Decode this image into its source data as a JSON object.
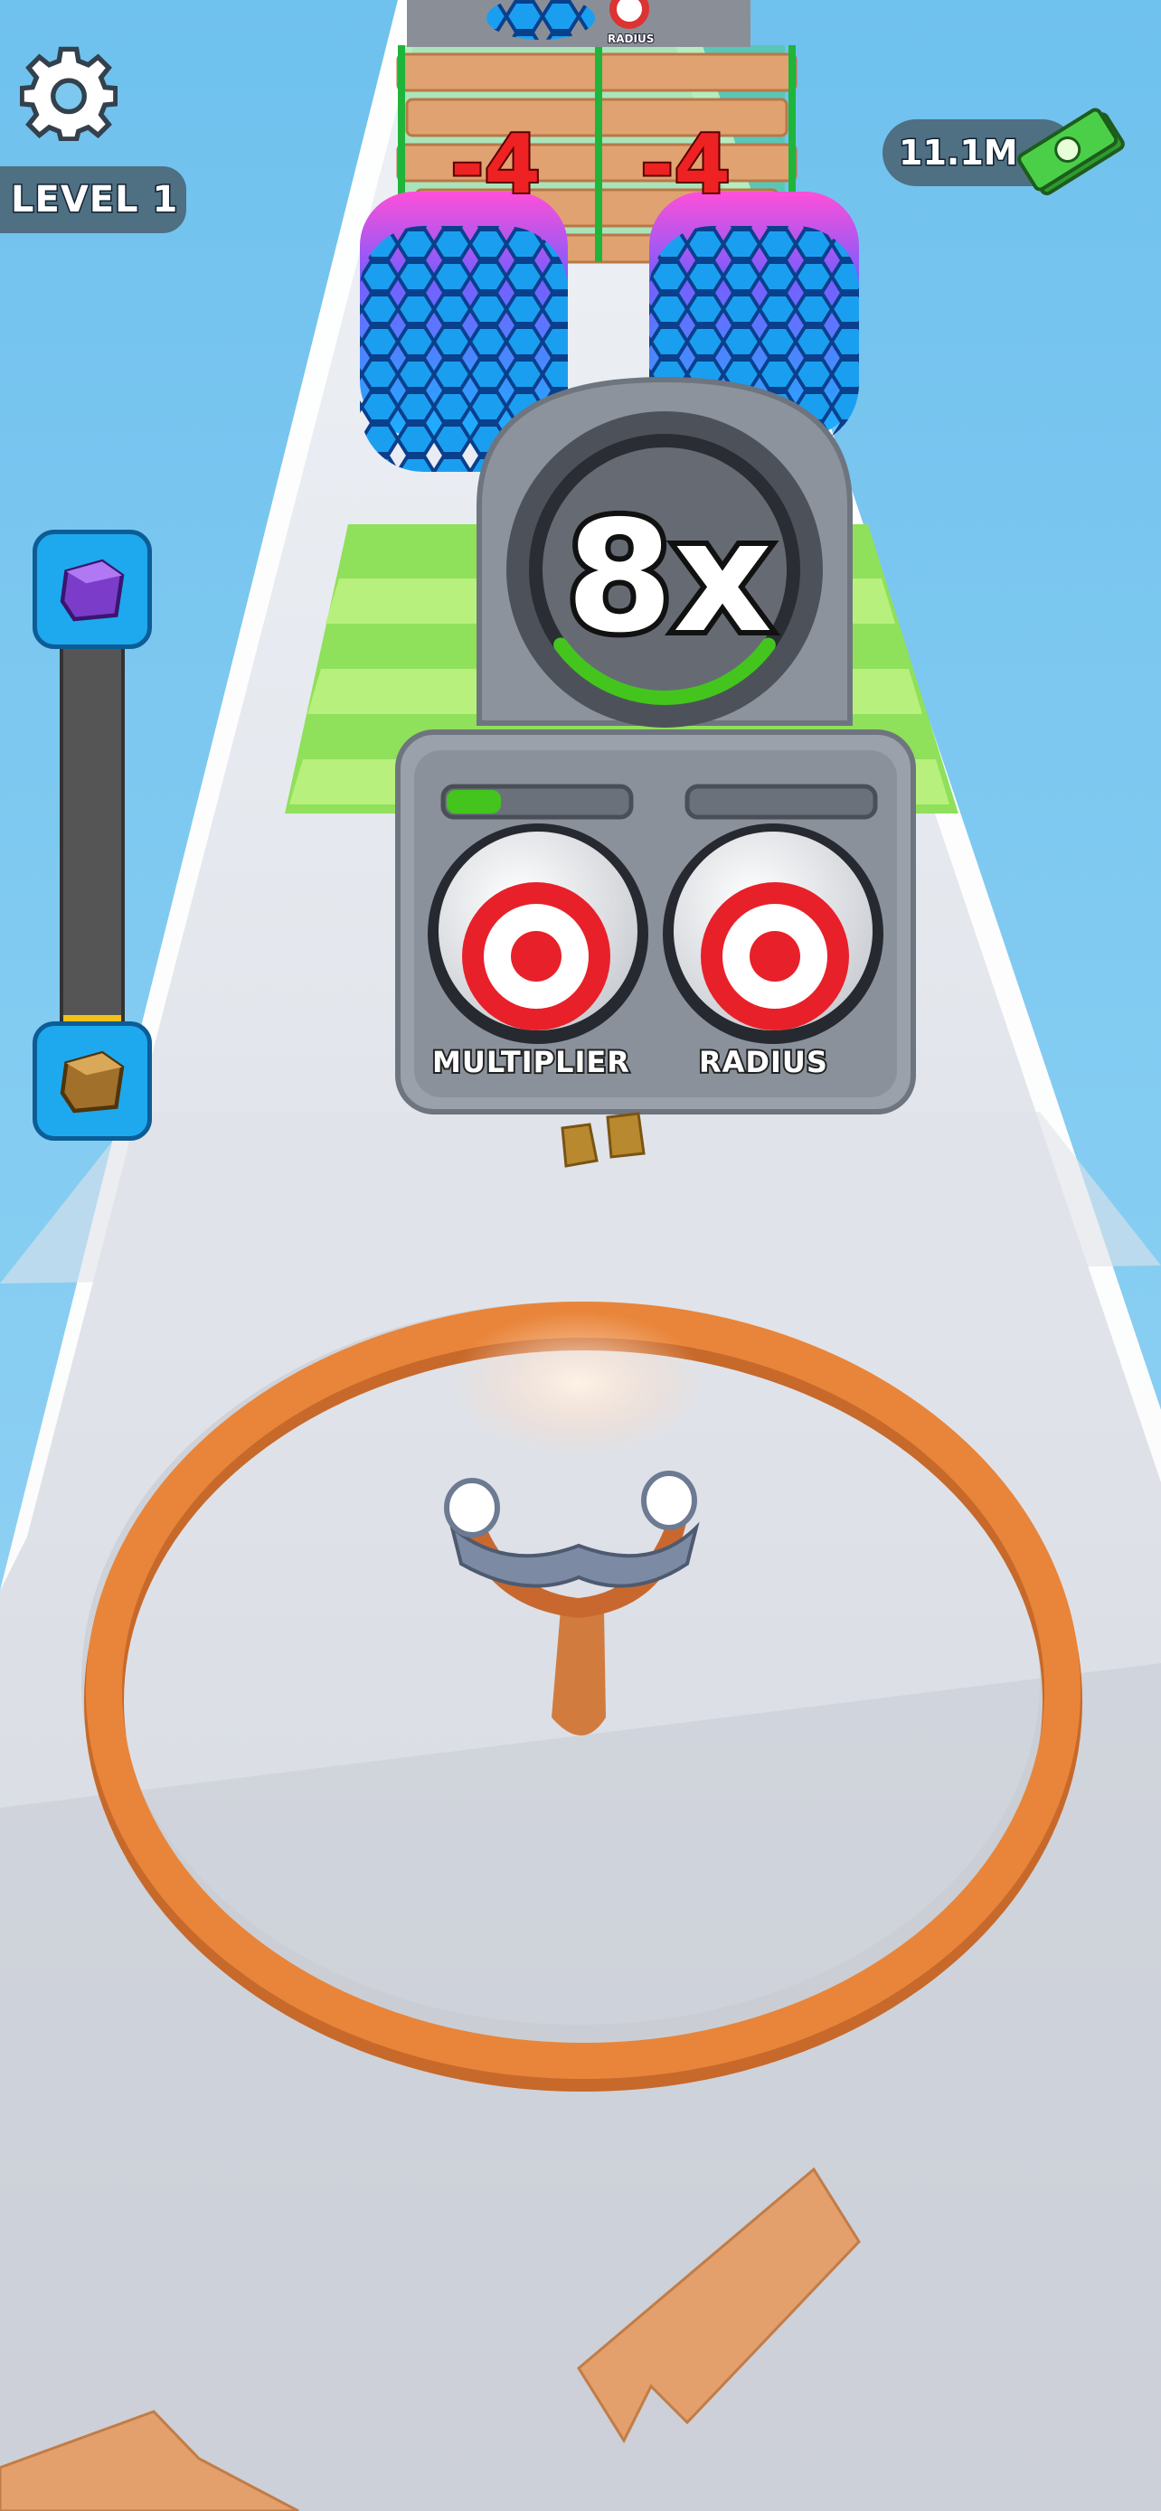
{
  "hud": {
    "level_label": "LEVEL 1",
    "money": "11.1M",
    "level_progress_fraction": 0.05
  },
  "gates": {
    "left_value": "-4",
    "right_value": "-4",
    "far_label": "RADIUS"
  },
  "upgrade_machine": {
    "multiplier_display": "8x",
    "multiplier_progress_fraction": 0.3,
    "radius_progress_fraction": 0.0,
    "buttons": [
      {
        "label": "MULTIPLIER"
      },
      {
        "label": "RADIUS"
      }
    ]
  },
  "colors": {
    "sky": "#7cc8ef",
    "track": "#e8ecf2",
    "ring": "#e8853a",
    "grass": "#8fe05a",
    "progress_green": "#43c51e",
    "gem_box": "#1ea9ef",
    "gold": "#f3c21a"
  },
  "icons": {
    "settings": "gear-icon",
    "money": "cash-stack-icon",
    "top_gem": "purple-gem-icon",
    "bottom_gem": "gold-gem-icon"
  }
}
